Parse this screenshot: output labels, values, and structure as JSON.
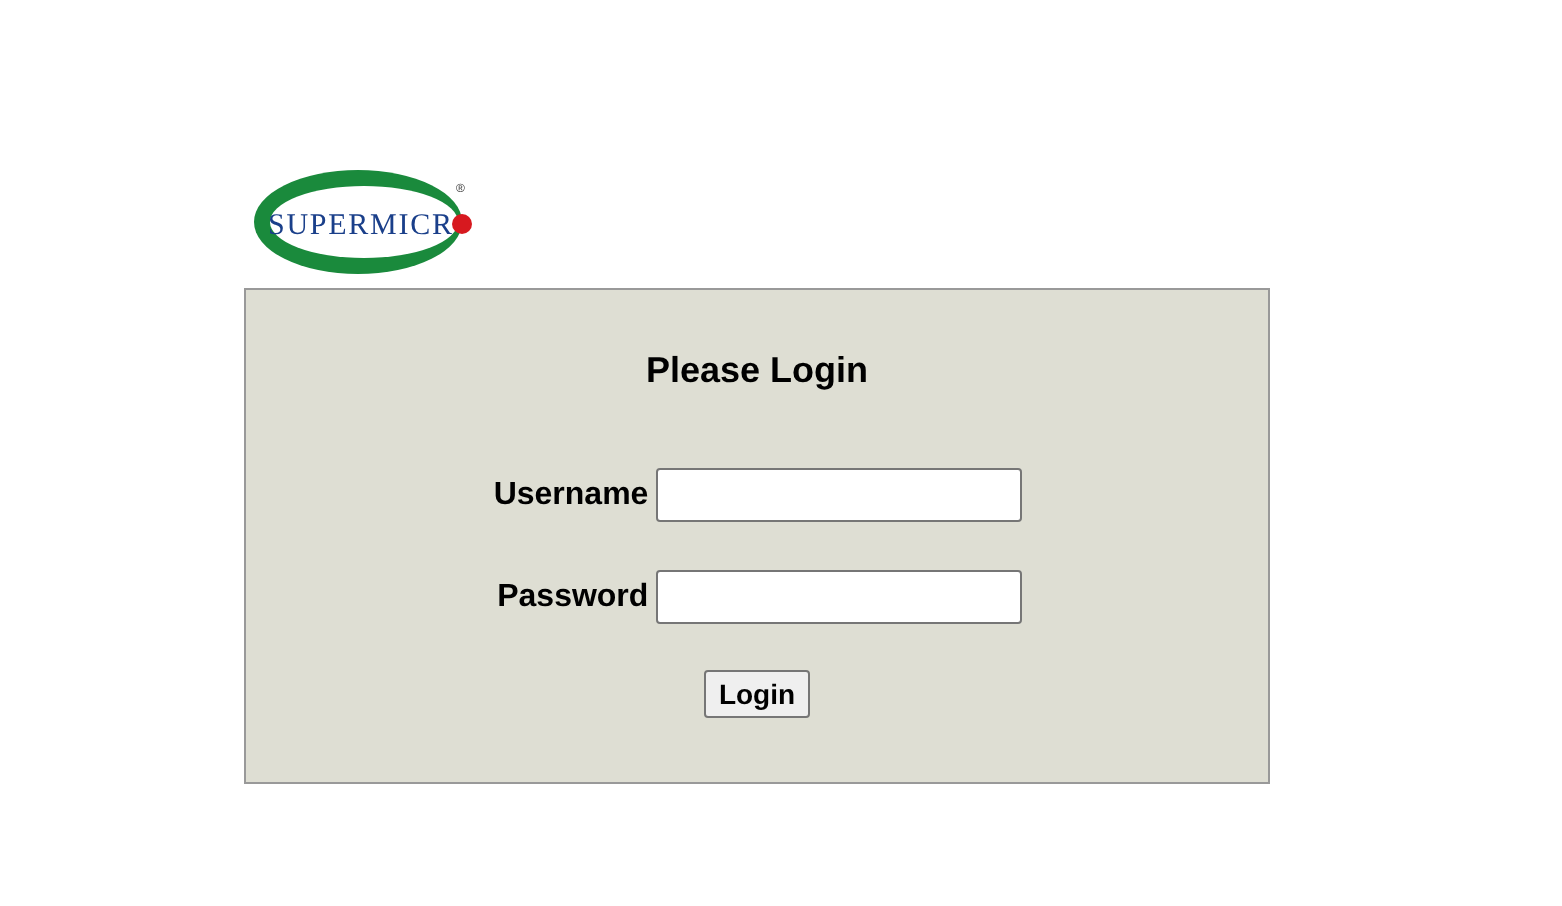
{
  "logo": {
    "text": "SUPERMICR",
    "mark": "®"
  },
  "login": {
    "title": "Please Login",
    "fields": [
      {
        "label": "Username"
      },
      {
        "label": "Password"
      }
    ],
    "button": "Login"
  }
}
